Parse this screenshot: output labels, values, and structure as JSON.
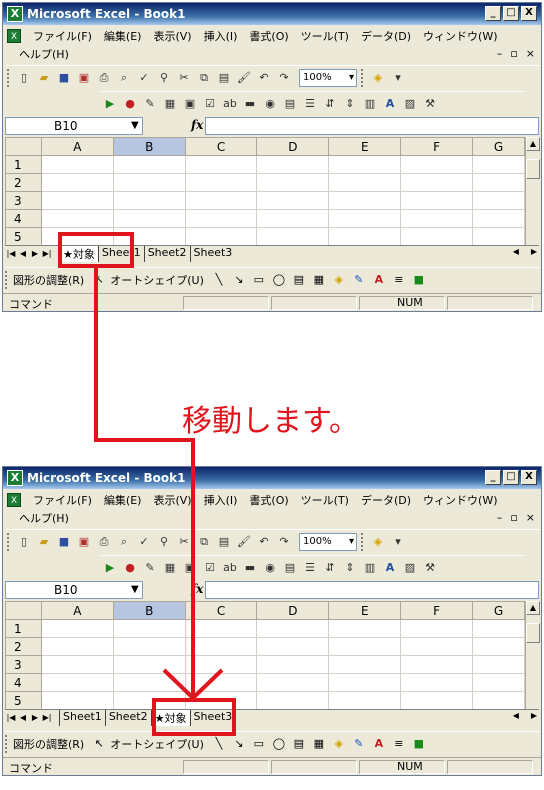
{
  "window": {
    "title": "Microsoft Excel - Book1",
    "app_icon": "excel-icon",
    "minimize": "_",
    "maximize": "□",
    "close": "X"
  },
  "menus": [
    "ファイル(F)",
    "編集(E)",
    "表示(V)",
    "挿入(I)",
    "書式(O)",
    "ツール(T)",
    "データ(D)",
    "ウィンドウ(W)"
  ],
  "menu_help": "ヘルプ(H)",
  "toolbar": {
    "zoom": "100%"
  },
  "formula_bar": {
    "name_box": "B10",
    "fx": "fx"
  },
  "grid": {
    "columns": [
      "A",
      "B",
      "C",
      "D",
      "E",
      "F",
      "G"
    ],
    "selected_column": "B",
    "rows_top": [
      "1",
      "2",
      "3",
      "4",
      "5"
    ],
    "rows_bottom": [
      "1",
      "2",
      "3",
      "4",
      "5"
    ]
  },
  "tabs_before": [
    "★対象",
    "Sheet1",
    "Sheet2",
    "Sheet3"
  ],
  "tabs_after": [
    "Sheet1",
    "Sheet2",
    "★対象",
    "Sheet3"
  ],
  "draw_toolbar": {
    "adjust": "図形の調整(R)",
    "autoshape": "オートシェイプ(U)"
  },
  "status": {
    "mode": "コマンド",
    "num": "NUM"
  },
  "caption": "移動します。",
  "colors": {
    "highlight": "#e0141c",
    "titlebar": "#0a246a"
  }
}
